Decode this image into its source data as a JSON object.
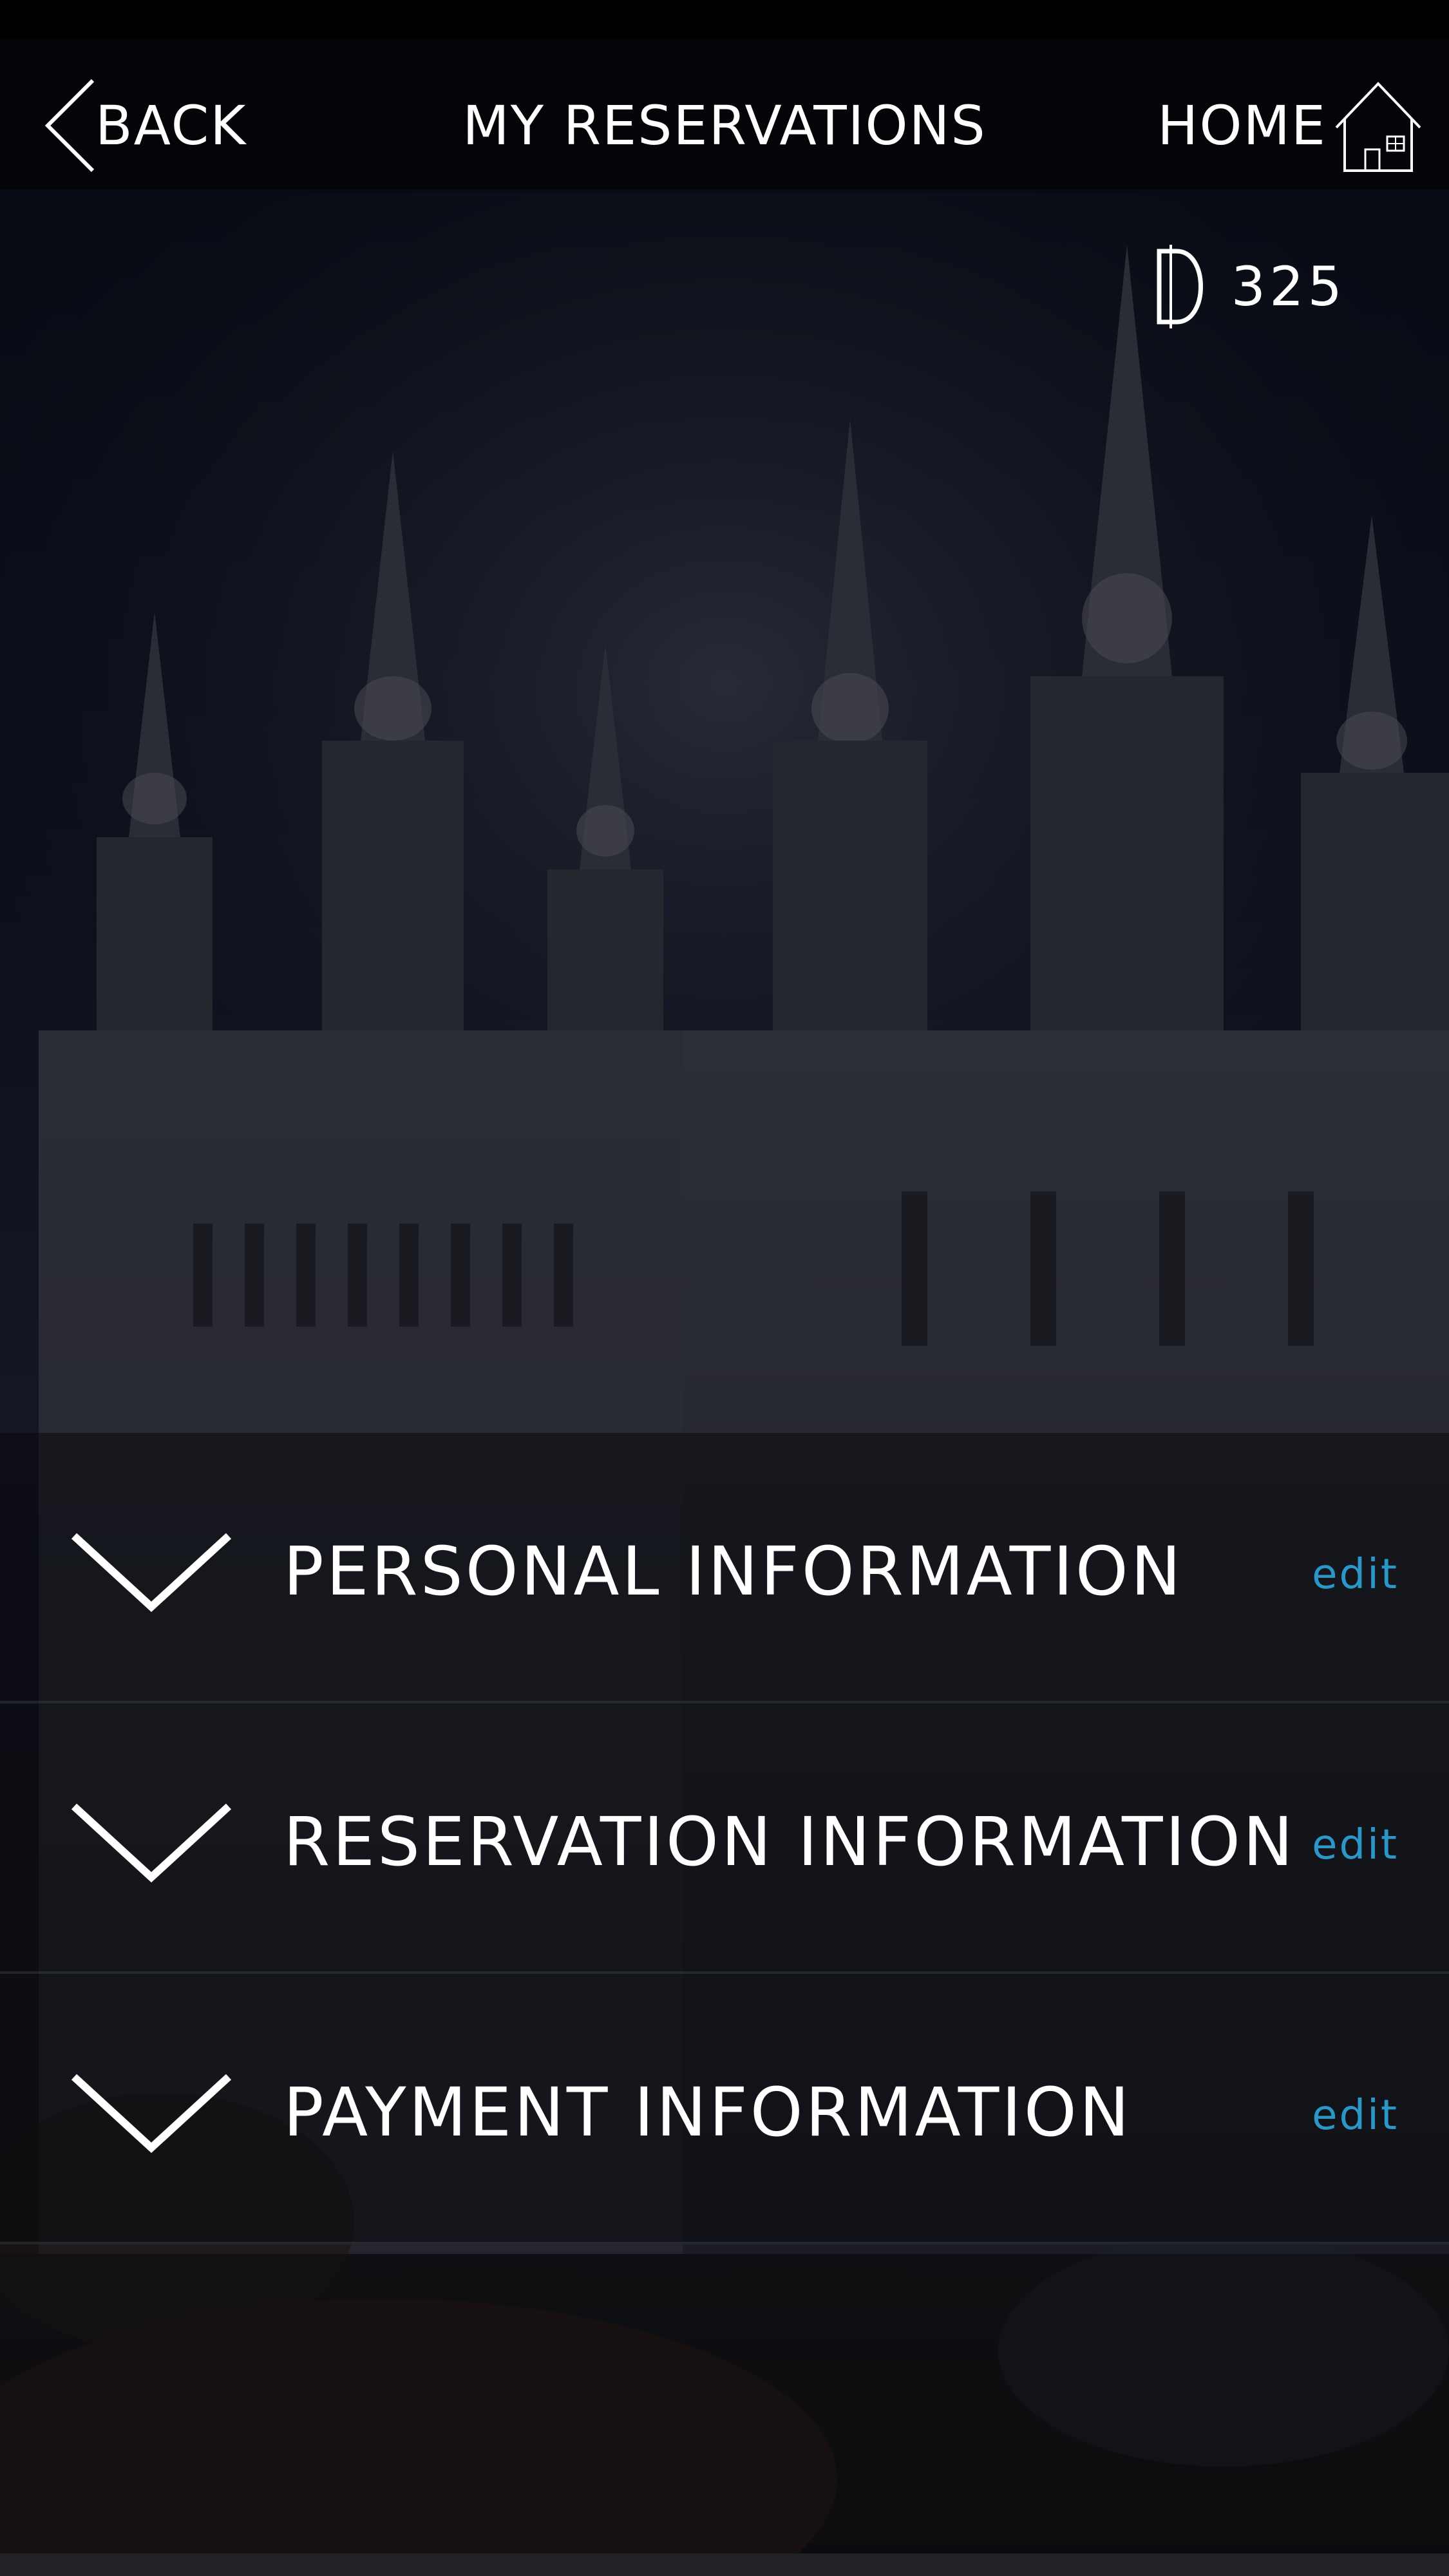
{
  "header": {
    "back_label": "BACK",
    "title": "MY RESERVATIONS",
    "home_label": "HOME"
  },
  "balance": {
    "currency_icon": "double-struck-d-icon",
    "value": "325"
  },
  "sections": [
    {
      "label": "PERSONAL INFORMATION",
      "edit_label": "edit"
    },
    {
      "label": "RESERVATION INFORMATION",
      "edit_label": "edit"
    },
    {
      "label": "PAYMENT INFORMATION",
      "edit_label": "edit"
    }
  ],
  "colors": {
    "accent": "#2b97c9",
    "text": "#ffffff",
    "header_bg": "#040508"
  }
}
